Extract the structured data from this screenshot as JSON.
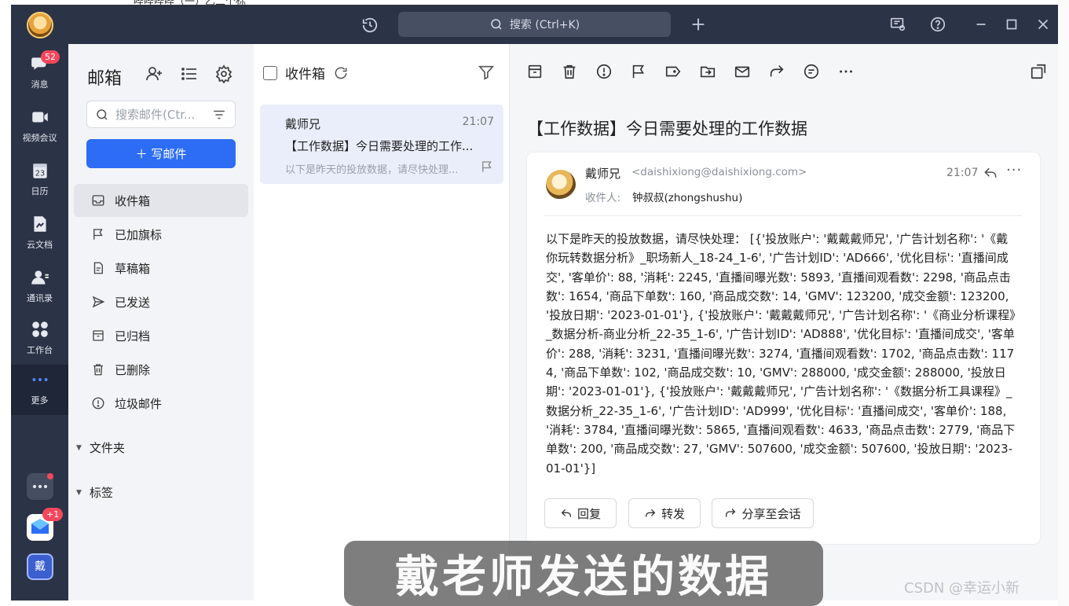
{
  "top_strip_text": "哔哔哔哔（一）乙二个标",
  "titlebar": {
    "search_placeholder": "搜索 (Ctrl+K)"
  },
  "rail": {
    "items": [
      {
        "label": "消息",
        "icon": "chat-bubble-icon",
        "badge": "52"
      },
      {
        "label": "视频会议",
        "icon": "video-camera-icon"
      },
      {
        "label": "日历",
        "icon": "calendar-icon",
        "day": "23"
      },
      {
        "label": "云文档",
        "icon": "cloud-doc-icon"
      },
      {
        "label": "通讯录",
        "icon": "contacts-icon"
      },
      {
        "label": "工作台",
        "icon": "apps-grid-icon"
      },
      {
        "label": "更多",
        "icon": "more-dots-icon"
      }
    ],
    "bottom_app_badge": "+1",
    "user_avatar_text": "戴"
  },
  "sidebar": {
    "title": "邮箱",
    "search_placeholder": "搜索邮件(Ctr...",
    "compose_label": "＋ 写邮件",
    "folders": [
      {
        "label": "收件箱",
        "icon": "inbox-icon"
      },
      {
        "label": "已加旗标",
        "icon": "flag-icon"
      },
      {
        "label": "草稿箱",
        "icon": "draft-icon"
      },
      {
        "label": "已发送",
        "icon": "send-icon"
      },
      {
        "label": "已归档",
        "icon": "archive-icon"
      },
      {
        "label": "已删除",
        "icon": "trash-icon"
      },
      {
        "label": "垃圾邮件",
        "icon": "spam-icon"
      }
    ],
    "sections": [
      "文件夹",
      "标签"
    ]
  },
  "list": {
    "title": "收件箱",
    "mail": {
      "sender": "戴师兄",
      "time": "21:07",
      "subject": "【工作数据】今日需要处理的工作...",
      "preview": "以下是昨天的投放数据，请尽快处理..."
    }
  },
  "reader": {
    "subject": "【工作数据】今日需要处理的工作数据",
    "sender": "戴师兄",
    "sender_email": "<daishixiong@daishixiong.com>",
    "recipient_label": "收件人:",
    "recipient": "钟叔叔(zhongshushu)",
    "time": "21:07",
    "body": "以下是昨天的投放数据，请尽快处理：  [{'投放账户': '戴戴戴师兄', '广告计划名称': '《戴你玩转数据分析》_职场新人_18-24_1-6', '广告计划ID': 'AD666', '优化目标': '直播间成交', '客单价': 88, '消耗': 2245, '直播间曝光数': 5893, '直播间观看数': 2298, '商品点击数': 1654, '商品下单数': 160, '商品成交数': 14, 'GMV': 123200, '成交金额': 123200, '投放日期': '2023-01-01'}, {'投放账户': '戴戴戴师兄', '广告计划名称': '《商业分析课程》_数据分析-商业分析_22-35_1-6', '广告计划ID': 'AD888', '优化目标': '直播间成交', '客单价': 288, '消耗': 3231, '直播间曝光数': 3274, '直播间观看数': 1702, '商品点击数': 1174, '商品下单数': 102, '商品成交数': 10, 'GMV': 288000, '成交金额': 288000, '投放日期': '2023-01-01'}, {'投放账户': '戴戴戴师兄', '广告计划名称': '《数据分析工具课程》_数据分析_22-35_1-6', '广告计划ID': 'AD999', '优化目标': '直播间成交', '客单价': 188, '消耗': 3784, '直播间曝光数': 5865, '直播间观看数': 4633, '商品点击数': 2779, '商品下单数': 200, '商品成交数': 27, 'GMV': 507600, '成交金额': 507600, '投放日期': '2023-01-01'}]",
    "buttons": {
      "reply": "回复",
      "forward": "转发",
      "share": "分享至会话"
    }
  },
  "overlay": {
    "subtitle": "戴老师发送的数据",
    "watermark": "CSDN @幸运小新"
  },
  "colors": {
    "titlebar": "#2b3346",
    "accent": "#2d6df6",
    "badge": "#f5475b",
    "sidebar_bg": "#f3f4f7",
    "selected_mail": "#e9eefa"
  }
}
